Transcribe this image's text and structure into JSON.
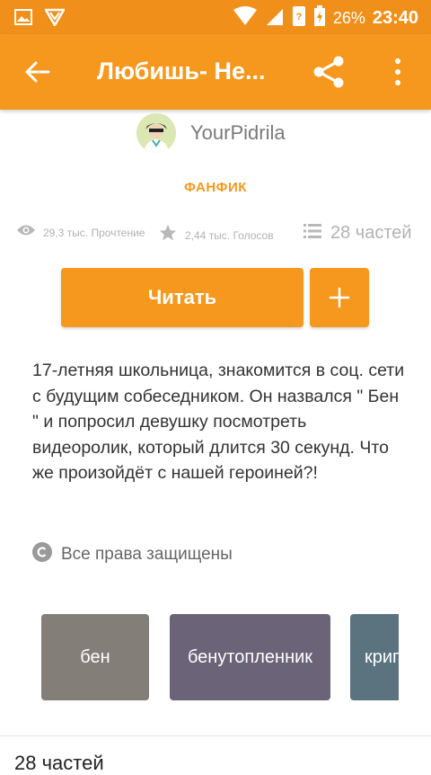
{
  "statusbar": {
    "battery": "26%",
    "time": "23:40",
    "icons": [
      "gallery-icon",
      "shield-icon",
      "wifi-icon",
      "signal-icon",
      "sim-icon",
      "battery-charging-icon"
    ]
  },
  "appbar": {
    "title": "Любишь- Не...",
    "back_icon": "arrow-back-icon",
    "share_icon": "share-icon",
    "more_icon": "more-vert-icon"
  },
  "author": {
    "name": "YourPidrila"
  },
  "category": "ФАНФИК",
  "stats": {
    "reads": "29,3 тыс. Прочтение",
    "votes": "2,44 тыс. Голосов",
    "parts": "28 частей"
  },
  "actions": {
    "read_label": "Читать",
    "add_icon": "plus-icon"
  },
  "description": "17-летняя школьница, знакомится в соц. сети с будущим собеседником. Он назвался \" Бен \" и попросил девушку посмотреть видеоролик, который длится 30 секунд. Что же произойдёт с нашей героиней?!",
  "copyright": "Все права защищены",
  "tags": [
    {
      "label": "бен",
      "color": "#847e78"
    },
    {
      "label": "бенутопленник",
      "color": "#6b6478"
    },
    {
      "label": "крипипаста",
      "color": "#5a737f"
    }
  ],
  "parts_section": {
    "title": "28 частей"
  },
  "colors": {
    "accent": "#f5981d",
    "statusbar": "#f0901a"
  }
}
